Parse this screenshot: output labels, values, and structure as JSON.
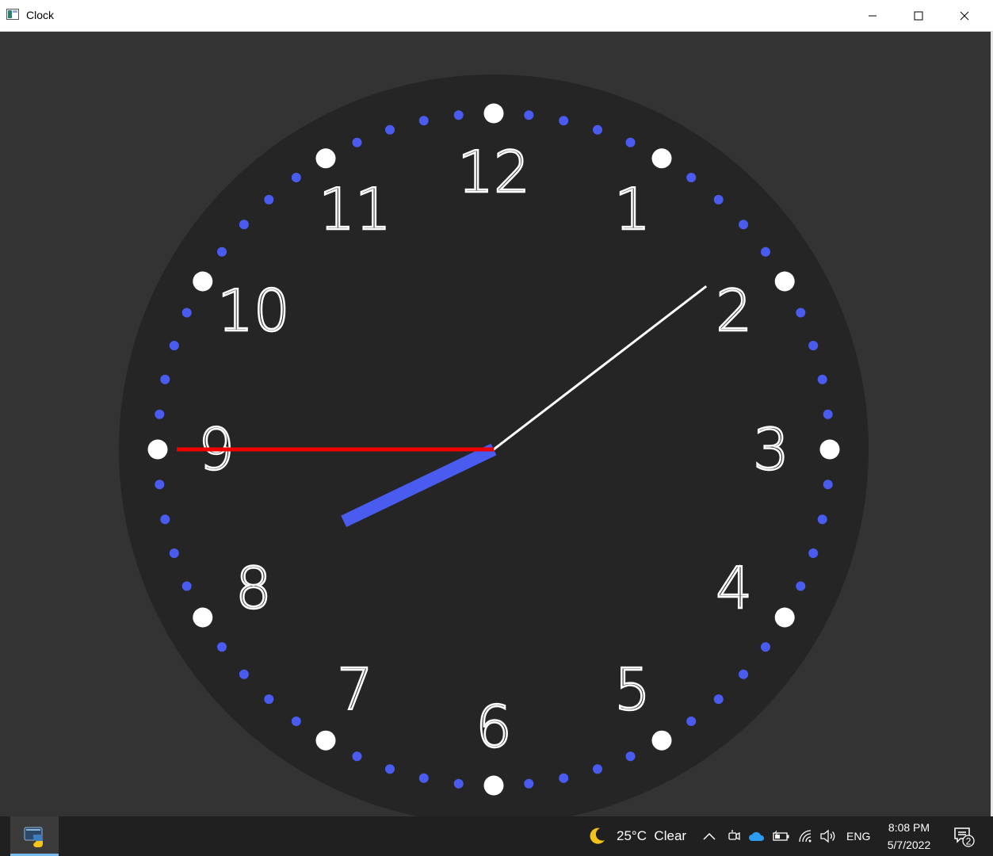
{
  "window": {
    "title": "Clock",
    "icon": "app-window-icon",
    "controls": [
      "minimize-icon",
      "maximize-icon",
      "close-icon"
    ]
  },
  "clock": {
    "face_color": "#252525",
    "background_color": "#333333",
    "numerals": [
      "12",
      "1",
      "2",
      "3",
      "4",
      "5",
      "6",
      "7",
      "8",
      "9",
      "10",
      "11"
    ],
    "time": {
      "hour": 8,
      "minute": 8,
      "second": 45
    },
    "hour_hand_color": "#4a5cf0",
    "minute_hand_color": "#ffffff",
    "second_hand_color": "#ee0000",
    "hour_marker_color": "#ffffff",
    "minute_marker_color": "#4a5cf0"
  },
  "taskbar": {
    "running_app": "python-app-icon",
    "weather": {
      "icon": "moon-icon",
      "text": "25°C  Clear"
    },
    "tray_icons": [
      "chevron-up-icon",
      "meet-now-icon",
      "onedrive-cloud-icon",
      "battery-icon",
      "wifi-icon",
      "volume-icon"
    ],
    "language": "ENG",
    "time": "8:08 PM",
    "date": "5/7/2022",
    "notification_count": "2"
  }
}
